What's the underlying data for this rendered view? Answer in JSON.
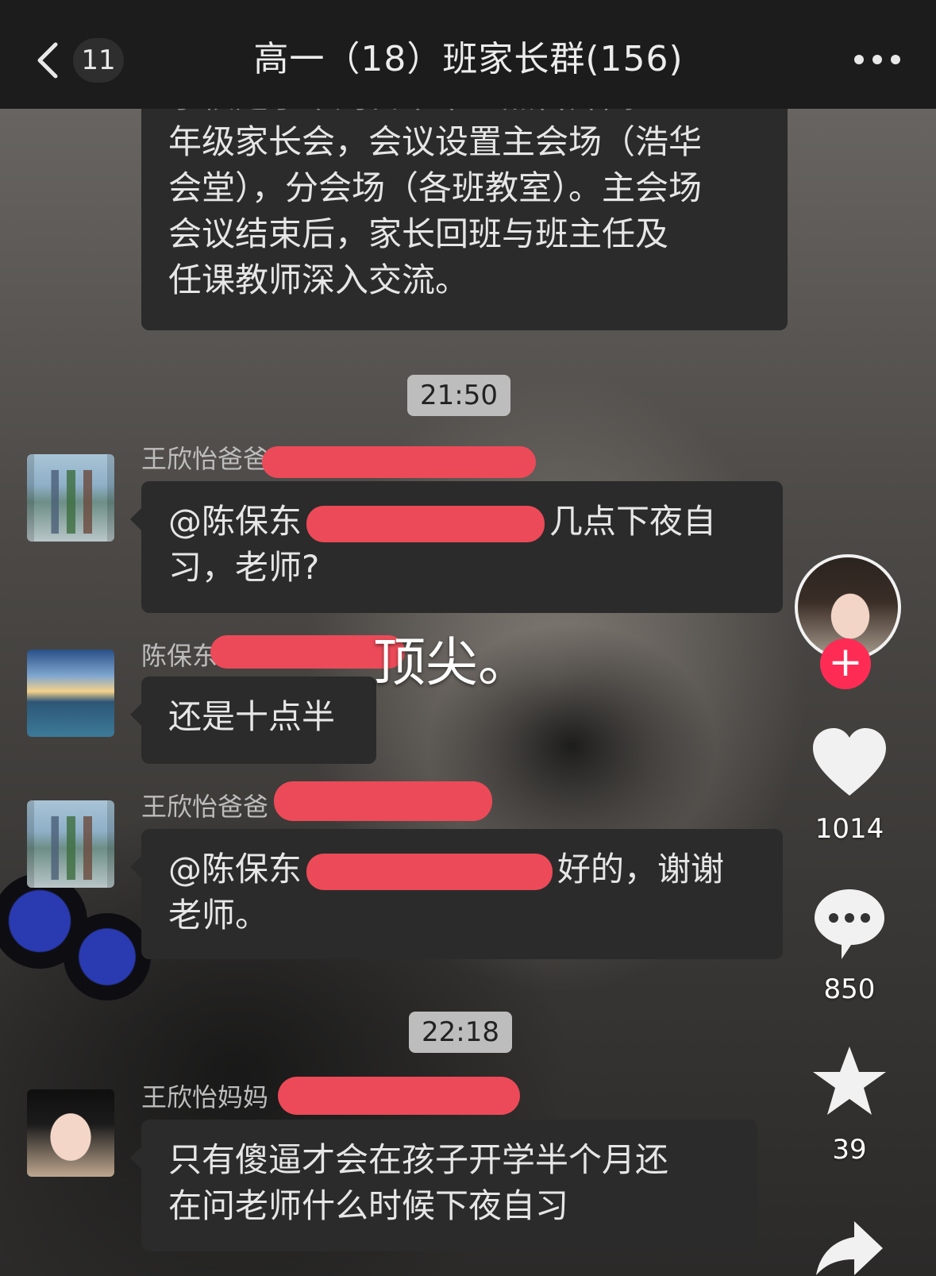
{
  "header": {
    "unread_count": "11",
    "title": "高一（18）班家长群(156)"
  },
  "messages": {
    "top_bubble_lines": [
      "学校定于本周日下午三点召开高",
      "年级家长会，会议设置主会场（浩华",
      "会堂），分会场（各班教室）。主会场",
      "会议结束后，家长回班与班主任及",
      "任课教师深入交流。"
    ],
    "time1": "21:50",
    "m1": {
      "sender": "王欣怡爸爸",
      "line1_a": "@陈保东",
      "line1_b": "几点下夜自",
      "line2": "习，老师?"
    },
    "m2": {
      "sender": "陈保东",
      "text": "还是十点半"
    },
    "m3": {
      "sender": "王欣怡爸爸",
      "line1_a": "@陈保东",
      "line1_b": "好的，谢谢",
      "line2": "老师。"
    },
    "time2": "22:18",
    "m4": {
      "sender": "王欣怡妈妈",
      "line1": "只有傻逼才会在孩子开学半个月还",
      "line2": "在问老师什么时候下夜自习"
    }
  },
  "overlay": {
    "caption": "顶尖。"
  },
  "rail": {
    "likes": "1014",
    "comments": "850",
    "favorites": "39"
  },
  "colors": {
    "redaction": "#ec4a58",
    "follow": "#fe2c55",
    "bubble": "#2b2b2b"
  }
}
